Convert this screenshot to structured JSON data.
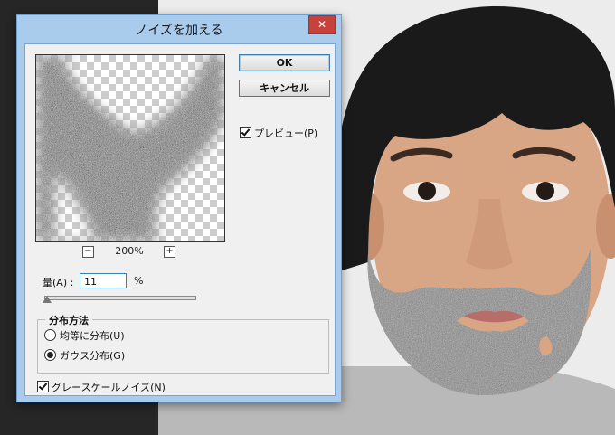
{
  "dialog": {
    "title": "ノイズを加える",
    "close_symbol": "✕",
    "ok_label": "OK",
    "cancel_label": "キャンセル",
    "preview_checkbox_label": "プレビュー(P)",
    "preview_checked": true,
    "zoom_minus": "−",
    "zoom_plus": "+",
    "zoom_value": "200%",
    "amount_label": "量(A) :",
    "amount_value": "11",
    "amount_unit": "%",
    "amount_slider_fraction": 0.01,
    "distribution_title": "分布方法",
    "distribution_options": [
      {
        "label": "均等に分布(U)",
        "selected": false
      },
      {
        "label": "ガウス分布(G)",
        "selected": true
      }
    ],
    "monochromatic_label": "グレースケールノイズ(N)",
    "monochromatic_checked": true
  },
  "colors": {
    "dialog_frame": "#a9cbec",
    "close_button": "#c7423a",
    "client_bg": "#f0f0f0",
    "ok_focus": "#3c7fb1"
  },
  "icons": {
    "zoom_out": "minus-square-icon",
    "zoom_in": "plus-square-icon",
    "close": "close-icon"
  }
}
